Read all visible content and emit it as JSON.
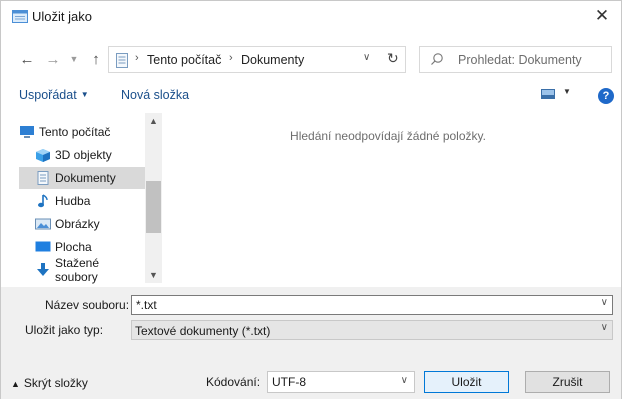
{
  "window": {
    "title": "Uložit jako"
  },
  "address": {
    "segments": [
      "Tento počítač",
      "Dokumenty"
    ]
  },
  "search": {
    "placeholder": "Prohledat: Dokumenty"
  },
  "toolbar": {
    "organize_label": "Uspořádat",
    "new_folder_label": "Nová složka"
  },
  "navpane": {
    "items": [
      {
        "label": "Tento počítač",
        "icon": "computer-icon"
      },
      {
        "label": "3D objekty",
        "icon": "cube-3d-icon"
      },
      {
        "label": "Dokumenty",
        "icon": "documents-icon",
        "selected": true
      },
      {
        "label": "Hudba",
        "icon": "music-icon"
      },
      {
        "label": "Obrázky",
        "icon": "pictures-icon"
      },
      {
        "label": "Plocha",
        "icon": "desktop-icon"
      },
      {
        "label": "Stažené soubory",
        "icon": "downloads-icon"
      }
    ]
  },
  "content": {
    "empty_message": "Hledání neodpovídají žádné položky."
  },
  "form": {
    "filename_label": "Název souboru:",
    "filename_value": "*.txt",
    "type_label": "Uložit jako typ:",
    "type_value": "Textové dokumenty (*.txt)",
    "encoding_label": "Kódování:",
    "encoding_value": "UTF-8"
  },
  "footer": {
    "hide_folders_label": "Skrýt složky"
  },
  "buttons": {
    "save_label": "Uložit",
    "cancel_label": "Zrušit"
  },
  "colors": {
    "accent": "#0078d7",
    "link": "#1a4f8b",
    "selection": "#d9d9d9",
    "help": "#1f69c9"
  }
}
